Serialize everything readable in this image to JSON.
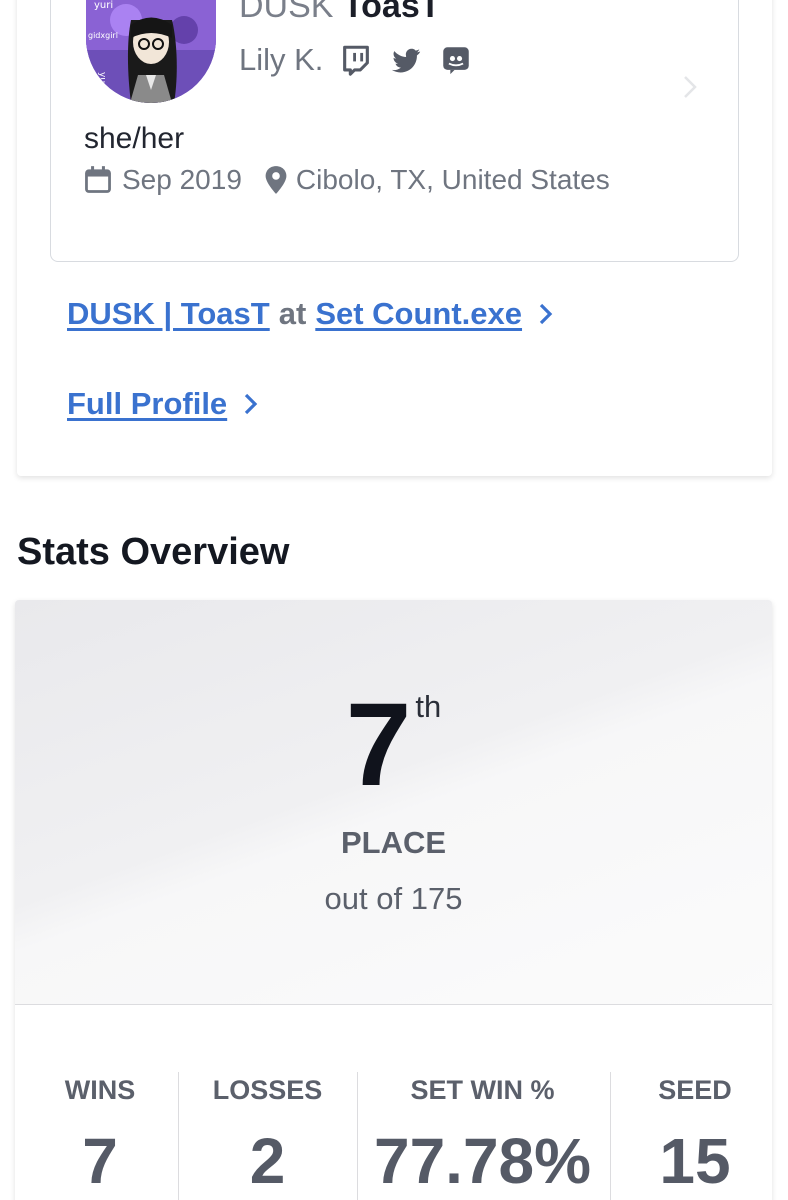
{
  "profile": {
    "prefix": "DUSK",
    "gamertag": "ToasT",
    "real_name": "Lily K.",
    "socials": [
      "twitch-icon",
      "twitter-icon",
      "discord-icon"
    ],
    "pronouns": "she/her",
    "joined": "Sep 2019",
    "location": "Cibolo, TX, United States",
    "avatar_texts": [
      "yuri",
      "girlxgirl",
      "gidxgirl",
      "yuri"
    ]
  },
  "links": {
    "entrant": {
      "name": "DUSK | ToasT",
      "at": "at",
      "event": "Set Count.exe"
    },
    "full_profile": "Full Profile"
  },
  "stats": {
    "section_title": "Stats Overview",
    "placement": "7",
    "placement_suffix": "th",
    "placement_label": "PLACE",
    "out_of": "out of 175",
    "columns": [
      {
        "label": "WINS",
        "value": "7"
      },
      {
        "label": "LOSSES",
        "value": "2"
      },
      {
        "label": "SET WIN %",
        "value": "77.78%"
      },
      {
        "label": "SEED",
        "value": "15"
      }
    ]
  },
  "colors": {
    "link": "#3a72cf",
    "text_muted": "#6f7580",
    "text_dark": "#1b1e28"
  }
}
